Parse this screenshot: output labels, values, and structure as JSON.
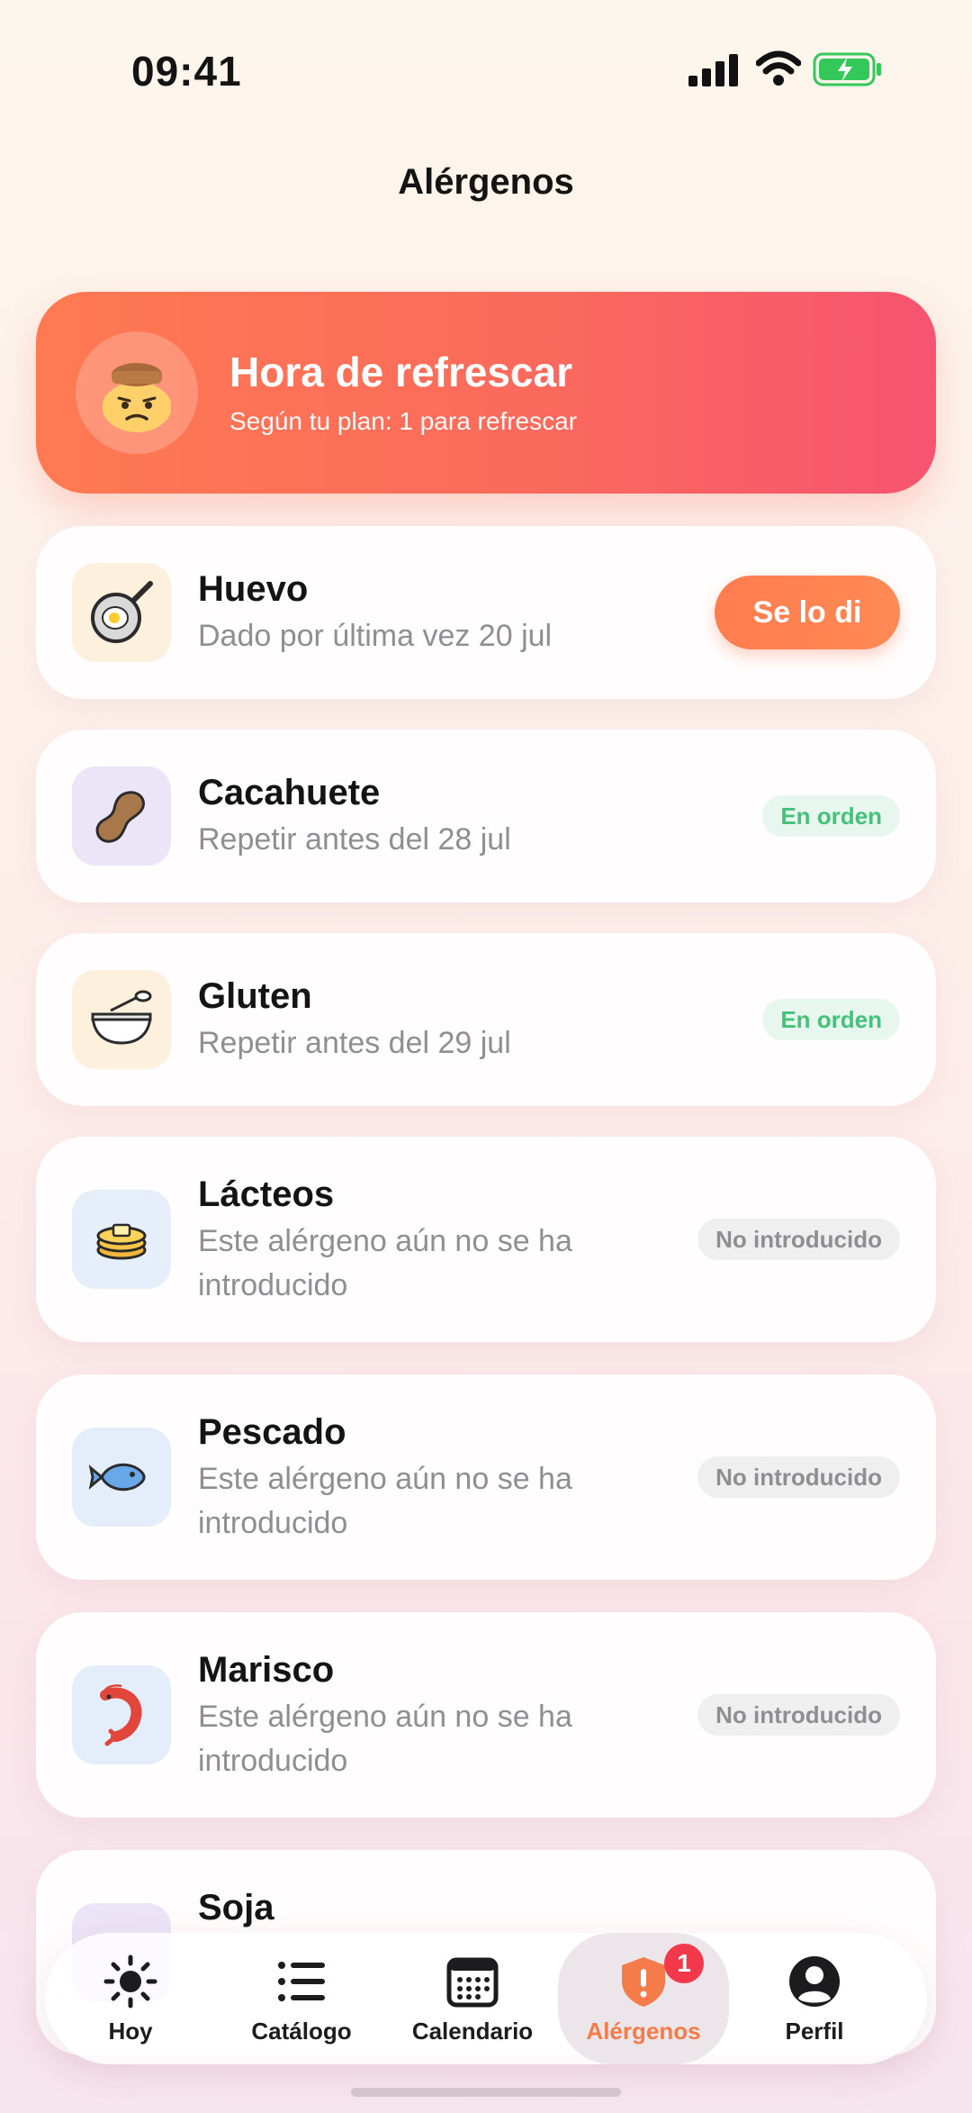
{
  "status_bar": {
    "time": "09:41"
  },
  "header": {
    "title": "Alérgenos"
  },
  "banner": {
    "title": "Hora de refrescar",
    "subtitle": "Según tu plan: 1 para refrescar"
  },
  "allergens": [
    {
      "name": "Huevo",
      "subtitle": "Dado por última vez 20 jul",
      "action": "Se lo di",
      "icon": "fried-egg-pan-icon",
      "tile_color": "#fdf0dc"
    },
    {
      "name": "Cacahuete",
      "subtitle": "Repetir antes del 28 jul",
      "status": "En orden",
      "icon": "peanut-icon",
      "tile_color": "#ece4f7"
    },
    {
      "name": "Gluten",
      "subtitle": "Repetir antes del 29 jul",
      "status": "En orden",
      "icon": "bowl-spoon-icon",
      "tile_color": "#fdf0dc"
    },
    {
      "name": "Lácteos",
      "subtitle": "Este alérgeno aún no se ha introducido",
      "status": "No introducido",
      "icon": "butter-pancake-icon",
      "tile_color": "#e6eef9"
    },
    {
      "name": "Pescado",
      "subtitle": "Este alérgeno aún no se ha introducido",
      "status": "No introducido",
      "icon": "fish-icon",
      "tile_color": "#e3eefa"
    },
    {
      "name": "Marisco",
      "subtitle": "Este alérgeno aún no se ha introducido",
      "status": "No introducido",
      "icon": "shrimp-icon",
      "tile_color": "#e3eefa"
    },
    {
      "name": "Soja",
      "subtitle": "",
      "icon": "soy-icon",
      "tile_color": "#ece4f7"
    }
  ],
  "tabbar": {
    "tabs": [
      {
        "label": "Hoy",
        "icon": "sun-icon"
      },
      {
        "label": "Catálogo",
        "icon": "list-icon"
      },
      {
        "label": "Calendario",
        "icon": "calendar-icon"
      },
      {
        "label": "Alérgenos",
        "icon": "shield-alert-icon",
        "badge": "1",
        "active": true
      },
      {
        "label": "Perfil",
        "icon": "profile-icon"
      }
    ]
  },
  "colors": {
    "accent": "#f47b4a",
    "ok_green": "#45c27a",
    "badge_red": "#f2394c"
  }
}
